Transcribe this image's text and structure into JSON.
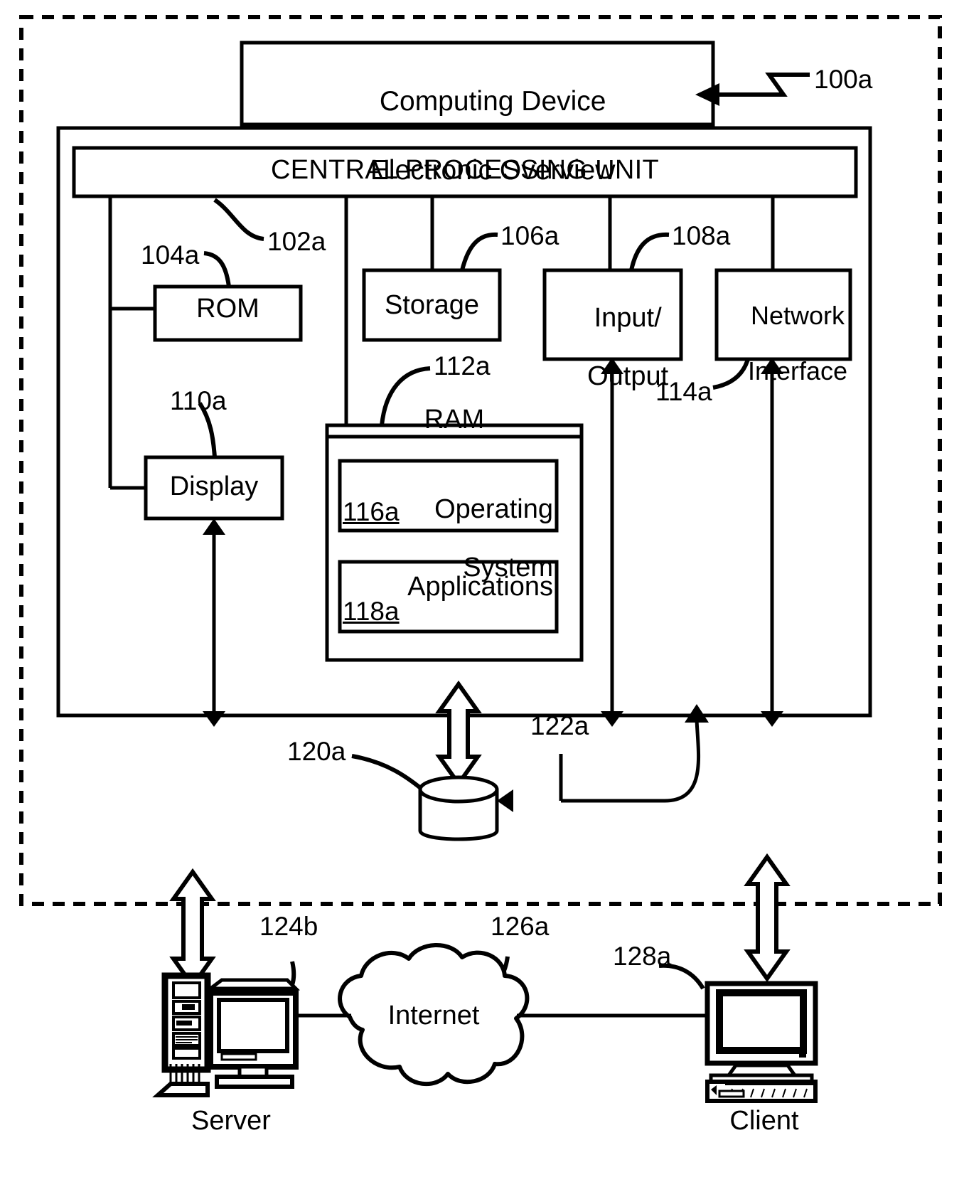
{
  "figure": {
    "title_box": {
      "line1": "Computing Device",
      "line2": "Electronic Overview",
      "ref": "100a"
    },
    "cpu": {
      "label": "CENTRAL PROCESSING UNIT",
      "ref": "102a"
    },
    "components": [
      {
        "name": "rom",
        "label": "ROM",
        "ref": "104a"
      },
      {
        "name": "storage",
        "label": "Storage",
        "ref": "106a"
      },
      {
        "name": "input-output",
        "label_line1": "Input/",
        "label_line2": "Output",
        "ref": "108a"
      },
      {
        "name": "network-interface",
        "label_line1": "Network",
        "label_line2": "Interface",
        "ref": "114a"
      },
      {
        "name": "display",
        "label": "Display",
        "ref": "110a"
      }
    ],
    "ram": {
      "label": "RAM",
      "ref": "112a",
      "contents": [
        {
          "name": "operating-system",
          "label_line1": "Operating",
          "label_line2": "System",
          "ref": "116a"
        },
        {
          "name": "applications",
          "label": "Applications",
          "ref": "118a"
        }
      ]
    },
    "database": {
      "ref": "120a",
      "incoming_ref": "122a"
    },
    "network": {
      "server": {
        "label": "Server",
        "ref": "124b"
      },
      "cloud": {
        "label": "Internet",
        "ref": "126a"
      },
      "client": {
        "label": "Client",
        "ref": "128a"
      }
    }
  },
  "colors": {
    "ink": "#000000",
    "paper": "#ffffff"
  }
}
